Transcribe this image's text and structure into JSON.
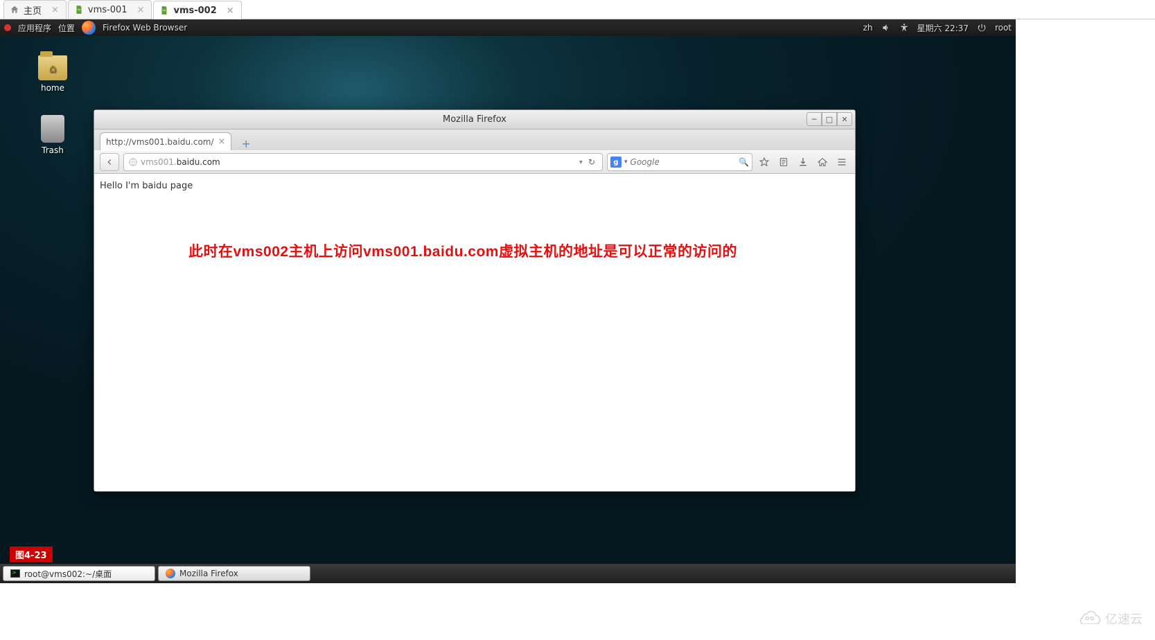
{
  "wiki_tabs": [
    {
      "label": "主页",
      "icon": "home",
      "active": false
    },
    {
      "label": "vms-001",
      "icon": "doc",
      "active": false
    },
    {
      "label": "vms-002",
      "icon": "doc",
      "active": true
    }
  ],
  "gnome": {
    "apps": "应用程序",
    "places": "位置",
    "active_app": "Firefox Web Browser",
    "ime": "zh",
    "day_time": "星期六 22:37",
    "user": "root"
  },
  "desktop_icons": {
    "home": "home",
    "trash": "Trash"
  },
  "firefox": {
    "window_title": "Mozilla Firefox",
    "tab_title": "http://vms001.baidu.com/",
    "url_gray": "vms001.",
    "url_dark": "baidu.com",
    "search_placeholder": "Google",
    "page_text": "Hello I'm baidu page",
    "annotation": "此时在vms002主机上访问vms001.baidu.com虚拟主机的地址是可以正常的访问的"
  },
  "figure_label": "图4-23",
  "taskbar": {
    "terminal": "root@vms002:~/桌面",
    "firefox": "Mozilla Firefox"
  },
  "watermark": "亿速云"
}
